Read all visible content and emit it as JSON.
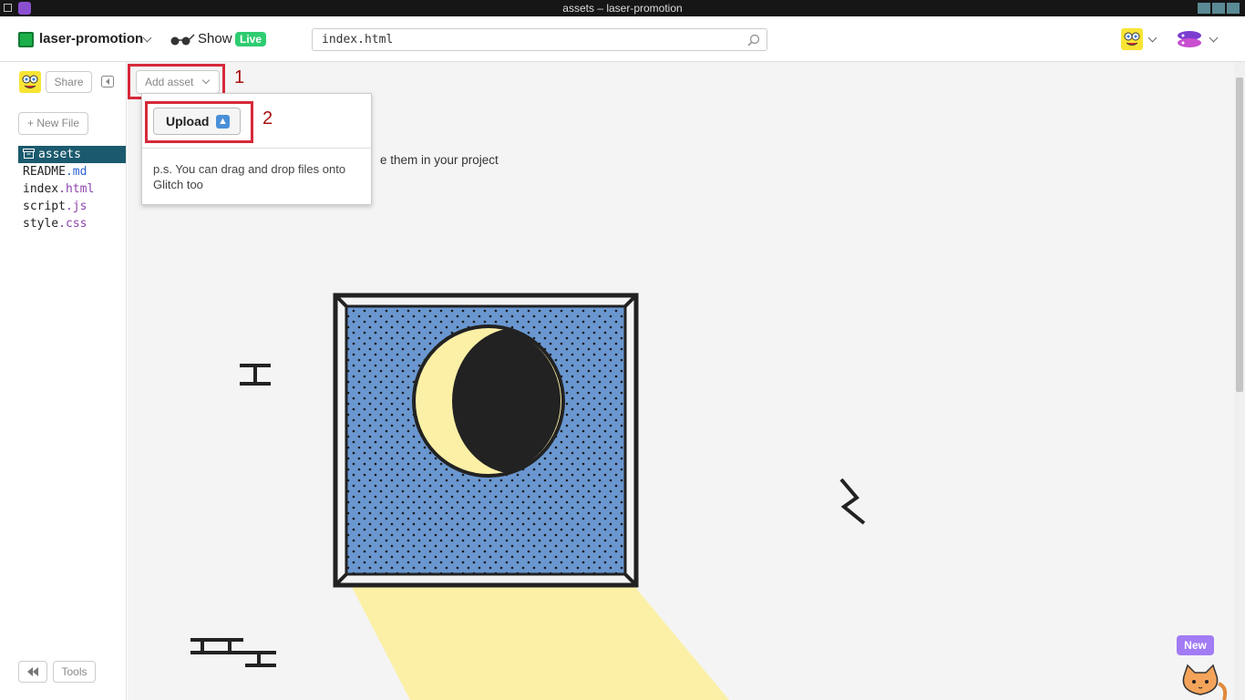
{
  "window": {
    "title": "assets – laser-promotion"
  },
  "header": {
    "project_name": "laser-promotion",
    "show_label": "Show",
    "live_badge": "Live",
    "search_value": "index.html",
    "icons": [
      "project-icon",
      "glasses-icon",
      "search-icon",
      "user-avatar",
      "team-avatar"
    ]
  },
  "sidebar": {
    "share_label": "Share",
    "new_file_label": "+ New File",
    "tools_label": "Tools",
    "files": [
      {
        "name": "assets",
        "ext": "",
        "active": true
      },
      {
        "name": "README",
        "ext": ".md"
      },
      {
        "name": "index",
        "ext": ".html"
      },
      {
        "name": "script",
        "ext": ".js"
      },
      {
        "name": "style",
        "ext": ".css"
      }
    ]
  },
  "main": {
    "add_asset_label": "Add asset",
    "upload_label": "Upload",
    "tip": "p.s. You can drag and drop files onto Glitch too",
    "hint_partial": "e them in your project",
    "annotation_1": "1",
    "annotation_2": "2",
    "new_badge": "New"
  },
  "colors": {
    "active_file_bg": "#1b5a6e",
    "live_green": "#2ecc71",
    "annotation_red": "#d6293a",
    "window_blue": "#6a97d0",
    "moon_yellow": "#fbf0a6",
    "new_badge_purple": "#a27cf4"
  }
}
